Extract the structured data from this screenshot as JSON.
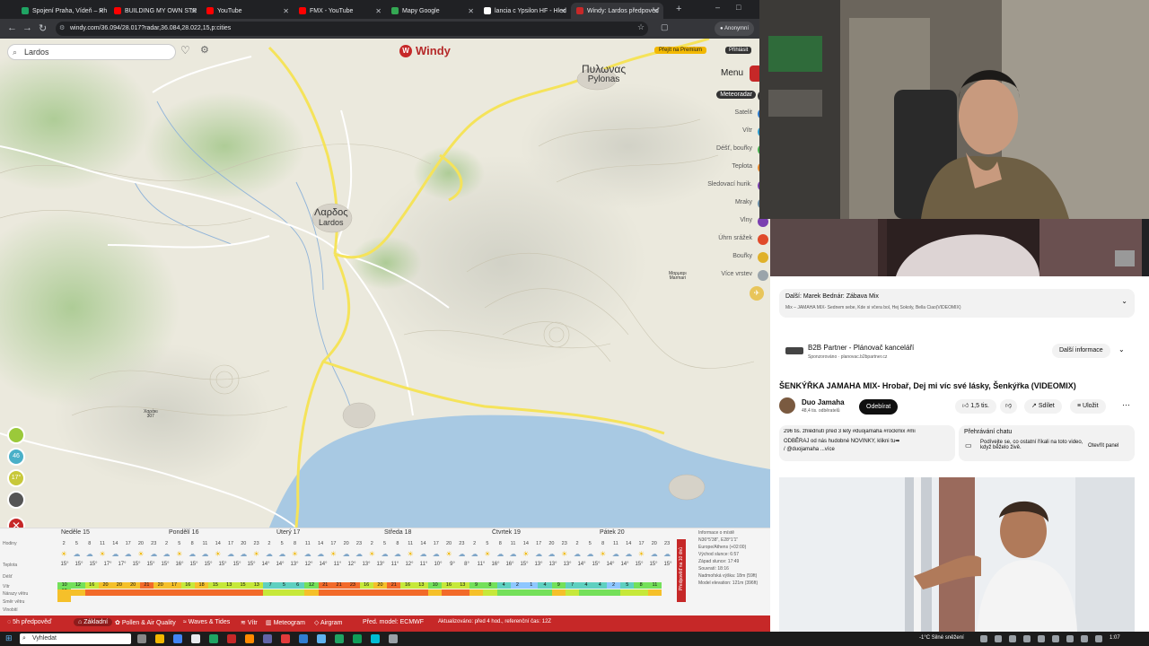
{
  "browser": {
    "tabs": [
      {
        "title": "Spojení Praha, Vídeň – Rh",
        "color": "#1fa463"
      },
      {
        "title": "BUILDING MY OWN STR",
        "color": "#ff0000"
      },
      {
        "title": "YouTube",
        "color": "#ff0000"
      },
      {
        "title": "FMX - YouTube",
        "color": "#ff0000"
      },
      {
        "title": "Mapy Google",
        "color": "#34a853"
      },
      {
        "title": "lancia c Ypsilon HF - Hled",
        "color": "#ffffff"
      },
      {
        "title": "Windy: Lardos předpověď",
        "color": "#c62828"
      }
    ],
    "url": "windy.com/36.094/28.017?radar,36.084,28.022,15,p:cities",
    "incognito": "Anonymní"
  },
  "map": {
    "search_value": "Lardos",
    "logo": "Windy",
    "premium_label": "Přejít na Premium",
    "login_label": "Přihlásit",
    "menu_label": "Menu",
    "layers": [
      {
        "label": "Meteoradar",
        "active": true,
        "color": "#333333"
      },
      {
        "label": "Satelit",
        "active": false,
        "color": "#2f7dd1"
      },
      {
        "label": "Vítr",
        "active": false,
        "color": "#2f9fd1"
      },
      {
        "label": "Déšť, bouřky",
        "active": false,
        "color": "#45b34d"
      },
      {
        "label": "Teplota",
        "active": false,
        "color": "#e8872a"
      },
      {
        "label": "Sledovací hurik.",
        "active": false,
        "color": "#7a3fb0"
      },
      {
        "label": "Mraky",
        "active": false,
        "color": "#6b8ea8"
      },
      {
        "label": "Vlny",
        "active": false,
        "color": "#7a3fb0"
      },
      {
        "label": "Úhrn srážek",
        "active": false,
        "color": "#e04a2a"
      },
      {
        "label": "Bouřky",
        "active": false,
        "color": "#e0b12a"
      },
      {
        "label": "Více vrstev",
        "active": false,
        "color": "#9aa4aa"
      }
    ],
    "places": [
      {
        "greek": "Πυλωνας",
        "latin": "Pylonas"
      },
      {
        "greek": "Λαρδος",
        "latin": "Lardos"
      },
      {
        "greek": "Μαρμαρι",
        "latin": "Marmari"
      },
      {
        "greek": "Χαράκι",
        "latin": "307"
      }
    ],
    "left_buttons": [
      {
        "icon": "location-icon",
        "text": "",
        "color": "#9bc93a"
      },
      {
        "icon": "wind-icon",
        "text": "46",
        "color": "#4ab0c8"
      },
      {
        "icon": "temp-icon",
        "text": "17°",
        "color": "#c8c83a"
      },
      {
        "icon": "webcam-icon",
        "text": "",
        "color": "#555555"
      }
    ]
  },
  "forecast": {
    "days": [
      "Neděle 15",
      "Pondělí 16",
      "Úterý 17",
      "Středa 18",
      "Čtvrtek 19",
      "Pátek 20"
    ],
    "row_labels": [
      "Hodiny",
      "Teplota",
      "Déšť",
      "Vítr",
      "Nárazy větru",
      "Směr větru",
      "Vlnobití"
    ],
    "hours": [
      "2",
      "5",
      "8",
      "11",
      "14",
      "17",
      "20",
      "23",
      "2",
      "5",
      "8",
      "11",
      "14",
      "17",
      "20",
      "23",
      "2",
      "5",
      "8",
      "11",
      "14",
      "17",
      "20",
      "23",
      "2",
      "5",
      "8",
      "11",
      "14",
      "17",
      "20",
      "23",
      "2",
      "5",
      "8",
      "11",
      "14",
      "17",
      "20",
      "23",
      "2",
      "5",
      "8",
      "11",
      "14",
      "17",
      "20",
      "23"
    ],
    "temps": [
      "15°",
      "15°",
      "15°",
      "17°",
      "17°",
      "15°",
      "15°",
      "15°",
      "16°",
      "15°",
      "15°",
      "15°",
      "15°",
      "15°",
      "14°",
      "14°",
      "13°",
      "12°",
      "14°",
      "11°",
      "12°",
      "13°",
      "13°",
      "11°",
      "12°",
      "11°",
      "10°",
      "9°",
      "8°",
      "11°",
      "16°",
      "16°",
      "15°",
      "13°",
      "13°",
      "13°",
      "14°",
      "15°",
      "14°",
      "14°",
      "15°",
      "15°",
      "15°"
    ],
    "wind": [
      "10",
      "12",
      "16",
      "20",
      "20",
      "20",
      "21",
      "20",
      "17",
      "16",
      "18",
      "15",
      "13",
      "15",
      "13",
      "7",
      "5",
      "6",
      "12",
      "21",
      "21",
      "23",
      "16",
      "20",
      "21",
      "16",
      "13",
      "10",
      "16",
      "13",
      "9",
      "8",
      "4",
      "2",
      "1",
      "4",
      "9",
      "7",
      "4",
      "4",
      "2",
      "5",
      "8",
      "11",
      "12"
    ],
    "info_lines": [
      "Informace o místě",
      "N36°5'38\", E28°1'1\"",
      "Europe/Athens (+02:00)",
      "Východ slunce: 6:57",
      "Západ slunce: 17:49",
      "Souvratí: 18:16",
      "Nadmořská výška: 18m (59ft)",
      "Model elevation: 121m (396ft)"
    ],
    "side_tab": "Předpověď na 10 dnů",
    "units": [
      "°C",
      "mm",
      "kt",
      "kt"
    ]
  },
  "bottom_bar": {
    "forecast_label": "5h předpověď",
    "items": [
      "Základní",
      "Pollen & Air Quality",
      "Waves & Tides",
      "Vítr",
      "Meteogram",
      "Airgram"
    ],
    "model": "Před. model: ECMWF",
    "updated": "Aktualizováno: před 4 hod., referenční čas: 12Z"
  },
  "youtube": {
    "next": "Další: Marek Bednár: Zábava Mix",
    "mix_desc": "Mix – JAMAHA MIX- Sednem sebe, Kde si včera bol, Hej Sokoly, Bella Ciao(VIDEOMIX)",
    "ad_title": "B2B Partner - Plánovač kanceláří",
    "ad_sponsored": "Sponzorováno · planovac.b2bpartner.cz",
    "ad_button": "Další informace",
    "title": "ŠENKÝŘKA JAMAHA MIX- Hrobař, Dej mi víc své lásky, Šenkýřka (VIDEOMIX)",
    "channel": "Duo Jamaha",
    "subs": "48,4 tis. odběratelů",
    "subscribe": "Odebírat",
    "likes": "1,5 tis.",
    "share": "Sdílet",
    "save": "Uložit",
    "views": "296 tis. zhlédnutí  před 3 lety  #duojamaha #rockmix #mi",
    "desc": "ODBĚRAJ od nás hudobné NOVINKY, klikni tu➡",
    "desc2": "/ @duojamaha ...více",
    "chat_title": "Přehrávání chatu",
    "chat_desc": "Podívejte se, co ostatní říkali na toto video, když běželo živě.",
    "chat_button": "Otevřít panel"
  },
  "taskbar": {
    "search": "Vyhledat",
    "weather": "-1°C  Silné sněžení",
    "time": "1:07"
  }
}
